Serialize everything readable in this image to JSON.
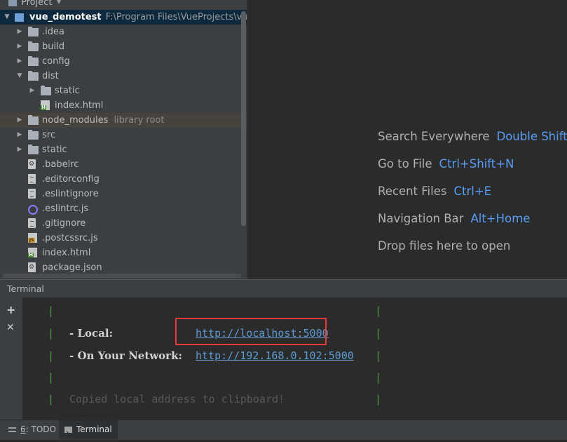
{
  "project_panel": {
    "title": "Project",
    "root": {
      "name": "vue_demotest",
      "path": "F:\\Program Files\\VueProjects\\vue_dem"
    },
    "items": [
      {
        "label": ".idea",
        "kind": "folder",
        "expandable": true,
        "expanded": false,
        "hint": ""
      },
      {
        "label": "build",
        "kind": "folder",
        "expandable": true,
        "expanded": false,
        "hint": ""
      },
      {
        "label": "config",
        "kind": "folder",
        "expandable": true,
        "expanded": false,
        "hint": ""
      },
      {
        "label": "dist",
        "kind": "folder",
        "expandable": true,
        "expanded": true,
        "hint": ""
      },
      {
        "label": "static",
        "kind": "folder",
        "expandable": true,
        "expanded": false,
        "hint": ""
      },
      {
        "label": "index.html",
        "kind": "html-file",
        "expandable": false,
        "hint": ""
      },
      {
        "label": "node_modules",
        "kind": "folder",
        "expandable": true,
        "expanded": false,
        "hint": "library root"
      },
      {
        "label": "src",
        "kind": "folder",
        "expandable": true,
        "expanded": false,
        "hint": ""
      },
      {
        "label": "static",
        "kind": "folder",
        "expandable": true,
        "expanded": false,
        "hint": ""
      },
      {
        "label": ".babelrc",
        "kind": "config-file",
        "expandable": false,
        "hint": ""
      },
      {
        "label": ".editorconfig",
        "kind": "text-file",
        "expandable": false,
        "hint": ""
      },
      {
        "label": ".eslintignore",
        "kind": "text-file",
        "expandable": false,
        "hint": ""
      },
      {
        "label": ".eslintrc.js",
        "kind": "eslint-file",
        "expandable": false,
        "hint": ""
      },
      {
        "label": ".gitignore",
        "kind": "text-file",
        "expandable": false,
        "hint": ""
      },
      {
        "label": ".postcssrc.js",
        "kind": "js-file",
        "expandable": false,
        "hint": ""
      },
      {
        "label": "index.html",
        "kind": "html-file",
        "expandable": false,
        "hint": ""
      },
      {
        "label": "package.json",
        "kind": "config-file",
        "expandable": false,
        "hint": ""
      }
    ]
  },
  "editor_hints": [
    {
      "text": "Search Everywhere",
      "key": "Double Shift"
    },
    {
      "text": "Go to File",
      "key": "Ctrl+Shift+N"
    },
    {
      "text": "Recent Files",
      "key": "Ctrl+E"
    },
    {
      "text": "Navigation Bar",
      "key": "Alt+Home"
    },
    {
      "text": "Drop files here to open",
      "key": ""
    }
  ],
  "terminal": {
    "title": "Terminal",
    "add_symbol": "+",
    "close_symbol": "✕",
    "border_char": "|",
    "local_label": "- Local:",
    "local_url": "http://localhost:5000",
    "network_label": "- On Your Network:",
    "network_url": "http://192.168.0.102:5000",
    "message": "Copied local address to clipboard!"
  },
  "bottom_bar": {
    "todo_number": "6",
    "todo_label": ": TODO",
    "terminal_label": "Terminal"
  },
  "colors": {
    "accent_link": "#5b9bd5",
    "hint_key": "#589df6",
    "highlight_box": "#e83a3a",
    "terminal_border": "#4f9d4a"
  }
}
